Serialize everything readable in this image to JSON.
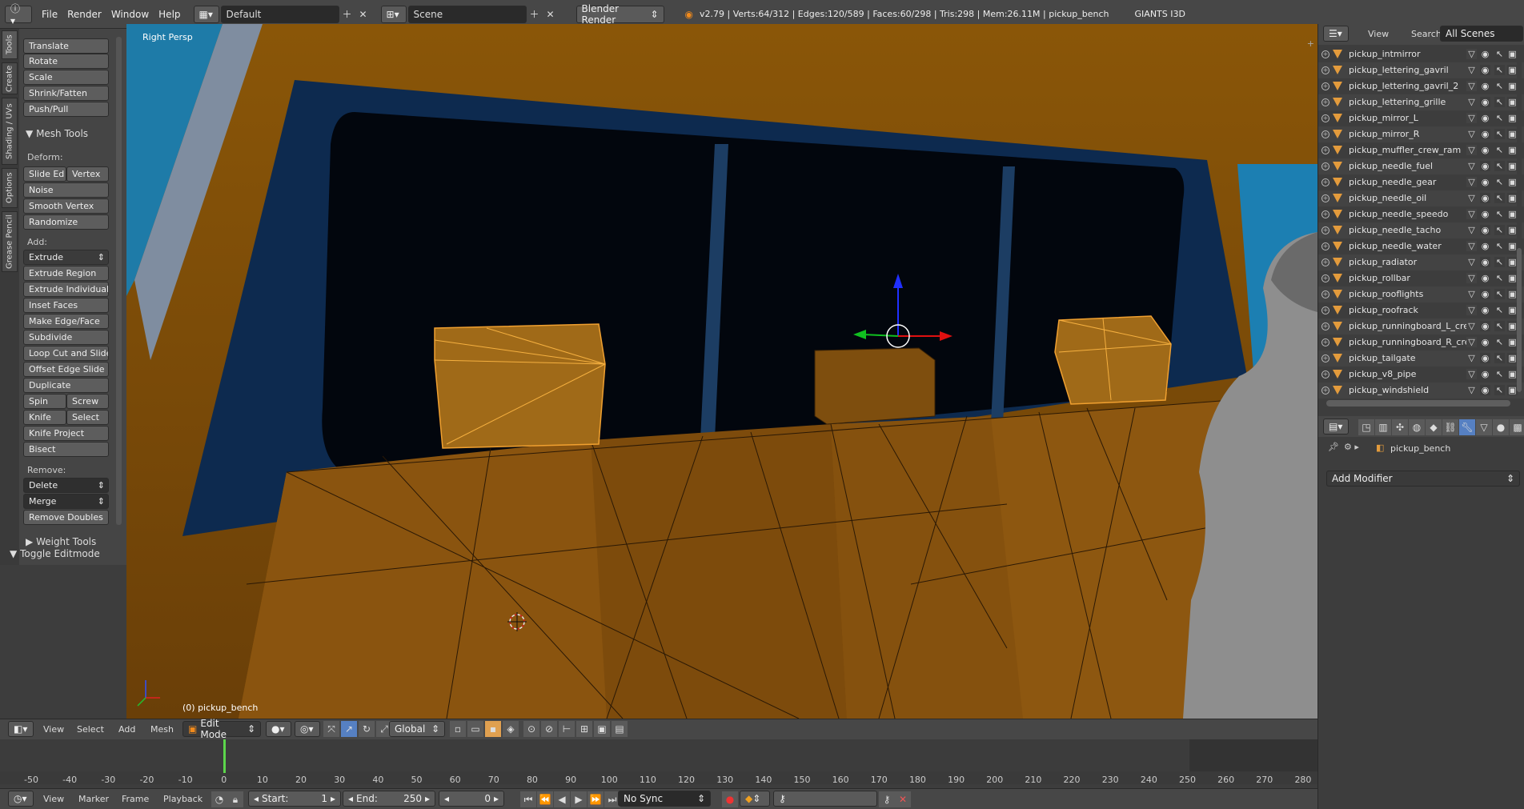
{
  "topbar": {
    "menus": [
      "File",
      "Render",
      "Window",
      "Help"
    ],
    "layout": "Default",
    "scene": "Scene",
    "engine": "Blender Render",
    "stats": "v2.79 | Verts:64/312 | Edges:120/589 | Faces:60/298 | Tris:298 | Mem:26.11M | pickup_bench",
    "addon": "GIANTS I3D"
  },
  "left_tabs": [
    "Tools",
    "Create",
    "Shading / UVs",
    "Options",
    "Grease Pencil"
  ],
  "tools": {
    "transform": [
      "Translate",
      "Rotate",
      "Scale",
      "Shrink/Fatten",
      "Push/Pull"
    ],
    "mesh_tools_header": "Mesh Tools",
    "deform_label": "Deform:",
    "slide_edge": "Slide Ed",
    "vertex": "Vertex",
    "deform": [
      "Noise",
      "Smooth Vertex",
      "Randomize"
    ],
    "add_label": "Add:",
    "extrude": "Extrude",
    "add": [
      "Extrude Region",
      "Extrude Individual",
      "Inset Faces",
      "Make Edge/Face",
      "Subdivide",
      "Loop Cut and Slide",
      "Offset Edge Slide",
      "Duplicate"
    ],
    "spin": "Spin",
    "screw": "Screw",
    "knife": "Knife",
    "select": "Select",
    "add2": [
      "Knife Project",
      "Bisect"
    ],
    "remove_label": "Remove:",
    "delete": "Delete",
    "merge": "Merge",
    "remove_doubles": "Remove Doubles",
    "weight_tools": "Weight Tools",
    "toggle_editmode": "Toggle Editmode"
  },
  "viewport": {
    "view_name": "Right Persp",
    "object_label": "(0) pickup_bench"
  },
  "viewport_header": {
    "menus": [
      "View",
      "Select",
      "Add",
      "Mesh"
    ],
    "mode": "Edit Mode",
    "orientation": "Global"
  },
  "timeline": {
    "ticks": [
      -50,
      -40,
      -30,
      -20,
      -10,
      0,
      10,
      20,
      30,
      40,
      50,
      60,
      70,
      80,
      90,
      100,
      110,
      120,
      130,
      140,
      150,
      160,
      170,
      180,
      190,
      200,
      210,
      220,
      230,
      240,
      250,
      260,
      270,
      280
    ],
    "current_frame": 0
  },
  "tl_footer": {
    "menus": [
      "View",
      "Marker",
      "Frame",
      "Playback"
    ],
    "start_label": "Start:",
    "start": "1",
    "end_label": "End:",
    "end": "250",
    "current": "0",
    "sync": "No Sync"
  },
  "outliner": {
    "view": "View",
    "search": "Search",
    "scenes": "All Scenes",
    "items": [
      "pickup_intmirror",
      "pickup_lettering_gavril",
      "pickup_lettering_gavril_2",
      "pickup_lettering_grille",
      "pickup_mirror_L",
      "pickup_mirror_R",
      "pickup_muffler_crew_ram",
      "pickup_needle_fuel",
      "pickup_needle_gear",
      "pickup_needle_oil",
      "pickup_needle_speedo",
      "pickup_needle_tacho",
      "pickup_needle_water",
      "pickup_radiator",
      "pickup_rollbar",
      "pickup_rooflights",
      "pickup_roofrack",
      "pickup_runningboard_L_crew",
      "pickup_runningboard_R_crew",
      "pickup_tailgate",
      "pickup_v8_pipe",
      "pickup_windshield"
    ]
  },
  "properties": {
    "object": "pickup_bench",
    "add_modifier": "Add Modifier"
  }
}
